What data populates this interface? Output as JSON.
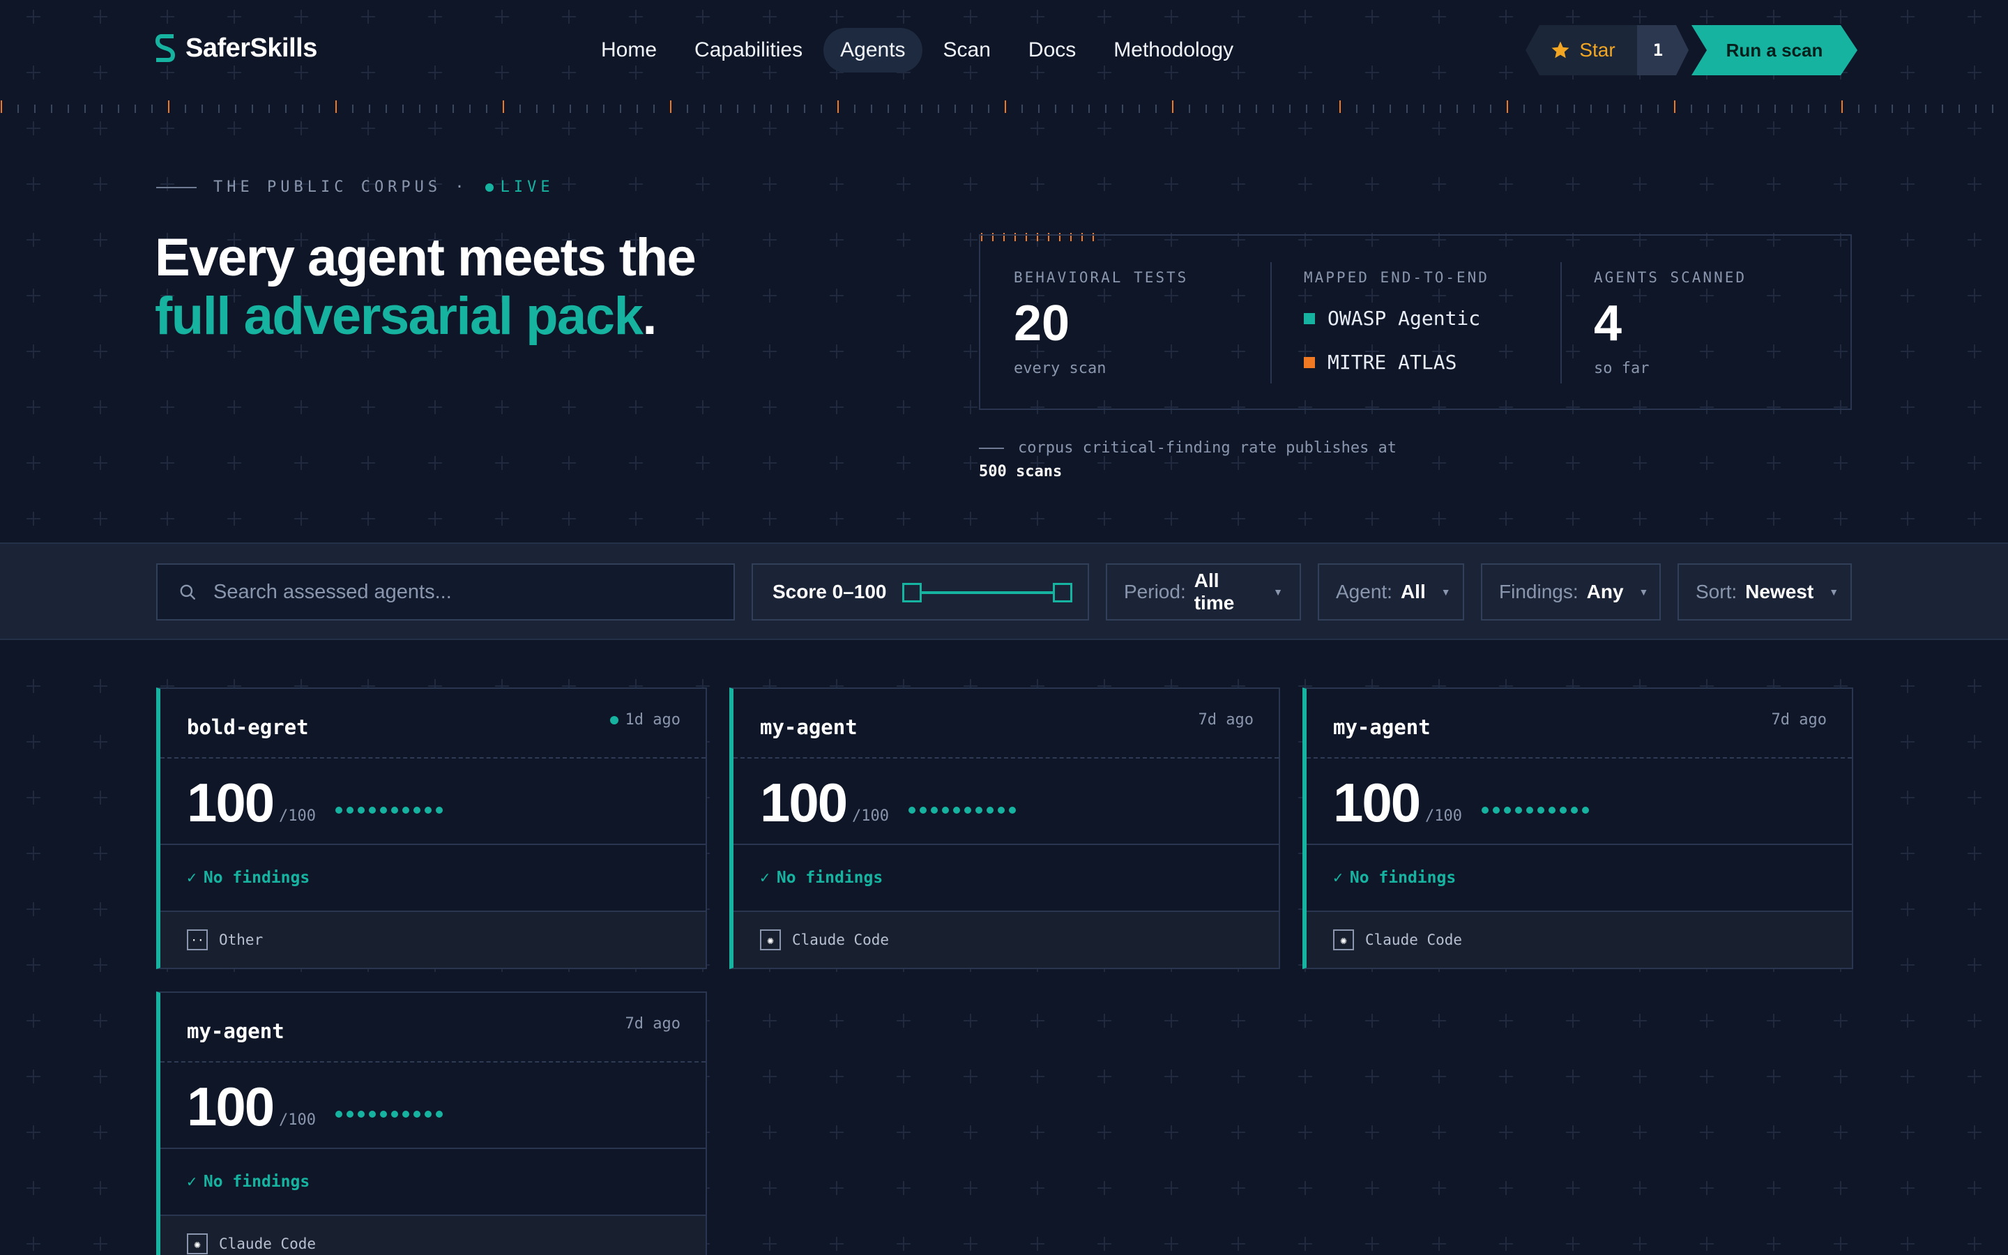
{
  "nav": {
    "brand": "SaferSkills",
    "items": [
      {
        "label": "Home",
        "active": false
      },
      {
        "label": "Capabilities",
        "active": false
      },
      {
        "label": "Agents",
        "active": true
      },
      {
        "label": "Scan",
        "active": false
      },
      {
        "label": "Docs",
        "active": false
      },
      {
        "label": "Methodology",
        "active": false
      }
    ],
    "star_label": "Star",
    "star_count": "1",
    "cta_label": "Run a scan"
  },
  "hero": {
    "kicker": "THE PUBLIC CORPUS ·",
    "live_label": "LIVE",
    "headline_line1": "Every agent meets the",
    "headline_accent": "full adversarial pack",
    "headline_end": "."
  },
  "stats": {
    "tests": {
      "label": "BEHAVIORAL TESTS",
      "value": "20",
      "sub": "every scan"
    },
    "mapped": {
      "label": "MAPPED END-TO-END",
      "items": [
        {
          "name": "OWASP Agentic",
          "color": "#16b4a0"
        },
        {
          "name": "MITRE ATLAS",
          "color": "#f07a24"
        }
      ]
    },
    "agents": {
      "label": "AGENTS SCANNED",
      "value": "4",
      "sub": "so far"
    },
    "note_text": "corpus critical-finding rate publishes at",
    "note_bold": "500 scans"
  },
  "filters": {
    "search_placeholder": "Search assessed agents...",
    "score_label": "Score 0–100",
    "score_min": 0,
    "score_max": 100,
    "period": {
      "label": "Period:",
      "value": "All time"
    },
    "agent": {
      "label": "Agent:",
      "value": "All"
    },
    "findings": {
      "label": "Findings:",
      "value": "Any"
    },
    "sort": {
      "label": "Sort:",
      "value": "Newest"
    }
  },
  "cards": [
    {
      "name": "bold-egret",
      "time": "1d ago",
      "fresh": true,
      "score": "100",
      "max": "/100",
      "findings": "No findings",
      "agent": "Other",
      "agent_icon": "dots-icon"
    },
    {
      "name": "my-agent",
      "time": "7d ago",
      "fresh": false,
      "score": "100",
      "max": "/100",
      "findings": "No findings",
      "agent": "Claude Code",
      "agent_icon": "claude-icon"
    },
    {
      "name": "my-agent",
      "time": "7d ago",
      "fresh": false,
      "score": "100",
      "max": "/100",
      "findings": "No findings",
      "agent": "Claude Code",
      "agent_icon": "claude-icon"
    },
    {
      "name": "my-agent",
      "time": "7d ago",
      "fresh": false,
      "score": "100",
      "max": "/100",
      "findings": "No findings",
      "agent": "Claude Code",
      "agent_icon": "claude-icon"
    }
  ],
  "colors": {
    "accent": "#16b4a0",
    "orange": "#f07a24",
    "star": "#f2a623",
    "background": "#0e1628"
  }
}
